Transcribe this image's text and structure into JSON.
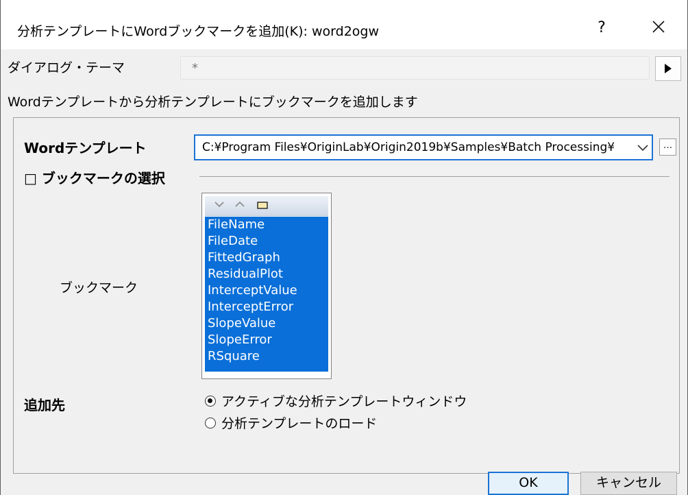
{
  "window": {
    "title": "分析テンプレートにWordブックマークを追加(K): word2ogw",
    "help_label": "?",
    "close_icon": "close-icon"
  },
  "theme": {
    "label": "ダイアログ・テーマ",
    "value": "*",
    "arrow_icon": "triangle-right-icon"
  },
  "description": "Wordテンプレートから分析テンプレートにブックマークを追加します",
  "word_template": {
    "label": "Wordテンプレート",
    "value": "C:¥Program Files¥OriginLab¥Origin2019b¥Samples¥Batch Processing¥",
    "browse_label": "..."
  },
  "bookmark_section": {
    "toggle_label": "□ ブックマークの選択",
    "list_label": "ブックマーク",
    "items": [
      "FileName",
      "FileDate",
      "FittedGraph",
      "ResidualPlot",
      "InterceptValue",
      "InterceptError",
      "SlopeValue",
      "SlopeError",
      "RSquare"
    ],
    "selection_color": "#0a6fd8"
  },
  "destination": {
    "label": "追加先",
    "options": [
      "アクティブな分析テンプレートウィンドウ",
      "分析テンプレートのロード"
    ],
    "selected_index": 0
  },
  "buttons": {
    "ok": "OK",
    "cancel": "キャンセル"
  }
}
